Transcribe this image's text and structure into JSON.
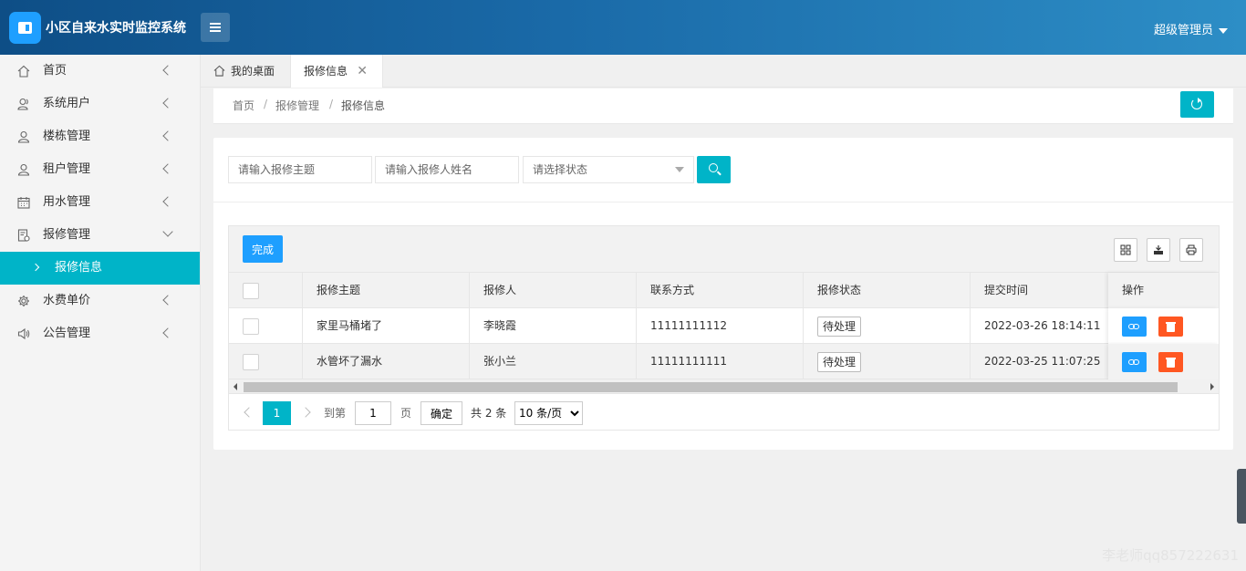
{
  "header": {
    "app_title": "小区自来水实时监控系统",
    "user": "超级管理员"
  },
  "sidebar": {
    "items": [
      {
        "label": "首页",
        "icon": "home-icon"
      },
      {
        "label": "系统用户",
        "icon": "users-icon"
      },
      {
        "label": "楼栋管理",
        "icon": "user-icon"
      },
      {
        "label": "租户管理",
        "icon": "user-icon"
      },
      {
        "label": "用水管理",
        "icon": "calendar-icon"
      },
      {
        "label": "报修管理",
        "icon": "repair-icon",
        "expanded": true
      },
      {
        "label": "报修信息",
        "active": true
      },
      {
        "label": "水费单价",
        "icon": "gear-icon"
      },
      {
        "label": "公告管理",
        "icon": "speaker-icon"
      }
    ]
  },
  "tabs": {
    "home": "我的桌面",
    "current": "报修信息",
    "close": "✕"
  },
  "breadcrumb": {
    "items": [
      "首页",
      "报修管理",
      "报修信息"
    ],
    "sep": "/"
  },
  "search": {
    "subject_placeholder": "请输入报修主题",
    "name_placeholder": "请输入报修人姓名",
    "status_placeholder": "请选择状态"
  },
  "table": {
    "done_label": "完成",
    "columns": [
      "报修主题",
      "报修人",
      "联系方式",
      "报修状态",
      "提交时间",
      "操作"
    ],
    "rows": [
      {
        "subject": "家里马桶堵了",
        "reporter": "李晓霞",
        "phone": "11111111112",
        "status": "待处理",
        "time": "2022-03-26 18:14:11"
      },
      {
        "subject": "水管坏了漏水",
        "reporter": "张小兰",
        "phone": "11111111111",
        "status": "待处理",
        "time": "2022-03-25 11:07:25"
      }
    ]
  },
  "pager": {
    "current_page": "1",
    "goto_label": "到第",
    "goto_value": "1",
    "page_unit": "页",
    "confirm": "确定",
    "total": "共 2 条",
    "page_size": "10 条/页"
  },
  "watermark": "李老师qq857222631",
  "colors": {
    "accent": "#00b4c8",
    "primary": "#1e9fff",
    "danger": "#ff5722",
    "header_start": "#0e4e86",
    "header_end": "#2d8ec6"
  }
}
